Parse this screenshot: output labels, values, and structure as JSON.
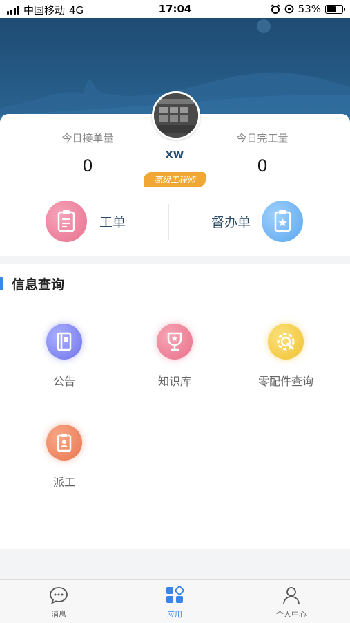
{
  "status_bar": {
    "carrier": "中国移动",
    "network": "4G",
    "time": "17:04",
    "battery": "53%"
  },
  "profile": {
    "username": "xw",
    "role": "高级工程师",
    "stats": [
      {
        "label": "今日接单量",
        "value": "0"
      },
      {
        "label": "今日完工量",
        "value": "0"
      }
    ],
    "actions": [
      {
        "label": "工单",
        "icon": "clipboard-icon"
      },
      {
        "label": "督办单",
        "icon": "starred-document-icon"
      }
    ]
  },
  "info_section": {
    "title": "信息查询",
    "items": [
      {
        "label": "公告",
        "icon": "announcement-book-icon"
      },
      {
        "label": "知识库",
        "icon": "trophy-icon"
      },
      {
        "label": "零配件查询",
        "icon": "wrench-gear-icon"
      },
      {
        "label": "派工",
        "icon": "dispatch-badge-icon"
      }
    ]
  },
  "tabbar": {
    "tabs": [
      {
        "label": "消息",
        "icon": "message-icon",
        "active": false
      },
      {
        "label": "应用",
        "icon": "apps-icon",
        "active": true
      },
      {
        "label": "个人中心",
        "icon": "person-icon",
        "active": false
      }
    ]
  },
  "colors": {
    "header": "#245a86",
    "accent_blue": "#3a86e8",
    "badge_orange": "#f0a733",
    "pink": "#ef8aa6"
  }
}
